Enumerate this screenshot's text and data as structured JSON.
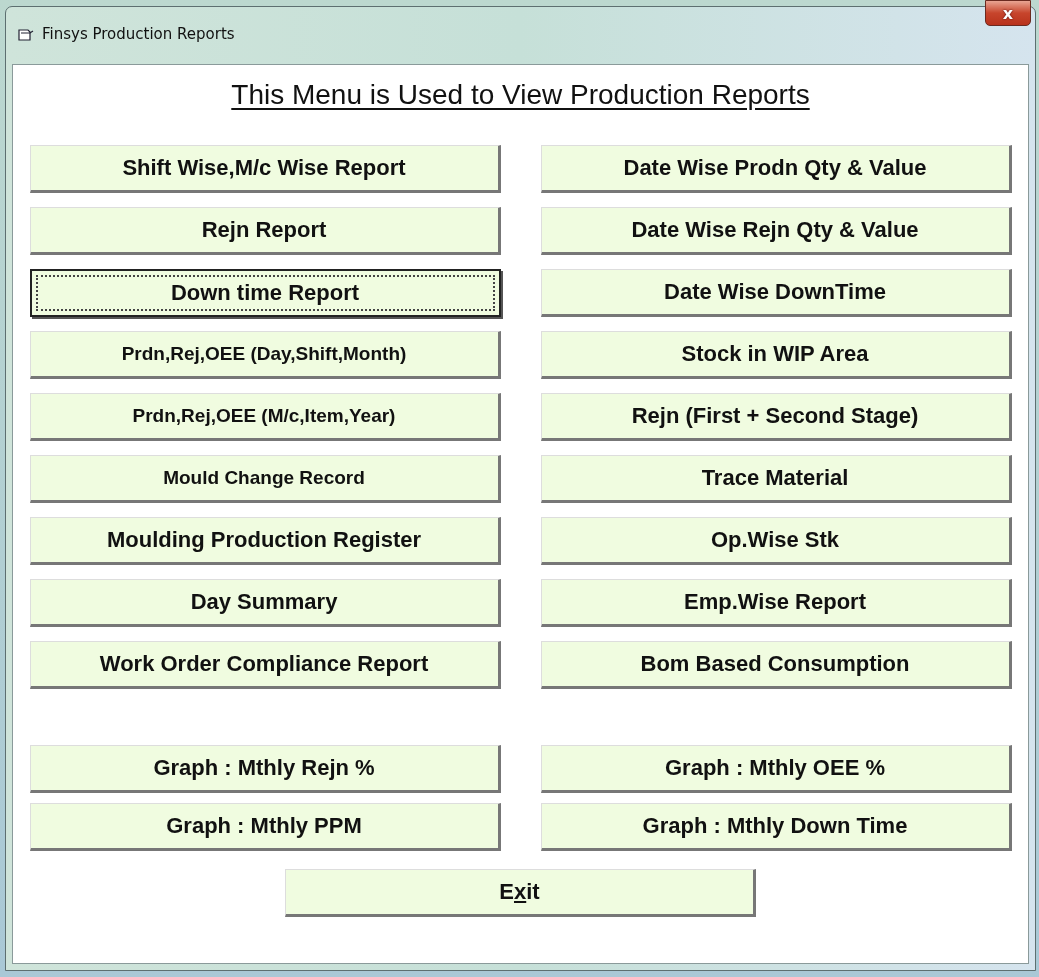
{
  "window": {
    "title": "Finsys Production Reports",
    "close_label": "x"
  },
  "heading": "This Menu is Used to View Production Reports",
  "report_buttons": [
    {
      "label": "Shift Wise,M/c Wise Report",
      "focused": false,
      "small": false
    },
    {
      "label": "Date Wise Prodn Qty & Value",
      "focused": false,
      "small": false
    },
    {
      "label": "Rejn Report",
      "focused": false,
      "small": false
    },
    {
      "label": "Date Wise Rejn Qty & Value",
      "focused": false,
      "small": false
    },
    {
      "label": "Down time Report",
      "focused": true,
      "small": false
    },
    {
      "label": "Date Wise DownTime",
      "focused": false,
      "small": false
    },
    {
      "label": "Prdn,Rej,OEE (Day,Shift,Month)",
      "focused": false,
      "small": true
    },
    {
      "label": "Stock in WIP Area",
      "focused": false,
      "small": false
    },
    {
      "label": "Prdn,Rej,OEE (M/c,Item,Year)",
      "focused": false,
      "small": true
    },
    {
      "label": "Rejn (First + Second Stage)",
      "focused": false,
      "small": false
    },
    {
      "label": "Mould Change Record",
      "focused": false,
      "small": true
    },
    {
      "label": "Trace Material",
      "focused": false,
      "small": false
    },
    {
      "label": "Moulding Production Register",
      "focused": false,
      "small": false
    },
    {
      "label": "Op.Wise Stk",
      "focused": false,
      "small": false
    },
    {
      "label": "Day Summary",
      "focused": false,
      "small": false
    },
    {
      "label": "Emp.Wise Report",
      "focused": false,
      "small": false
    },
    {
      "label": "Work Order Compliance Report",
      "focused": false,
      "small": false
    },
    {
      "label": "Bom Based Consumption",
      "focused": false,
      "small": false
    }
  ],
  "graph_buttons": [
    {
      "label": "Graph : Mthly Rejn %",
      "focused": false,
      "small": false
    },
    {
      "label": "Graph : Mthly OEE %",
      "focused": false,
      "small": false
    },
    {
      "label": "Graph : Mthly PPM",
      "focused": false,
      "small": false
    },
    {
      "label": "Graph : Mthly Down Time",
      "focused": false,
      "small": false
    }
  ],
  "exit_button": {
    "before": "E",
    "mnemonic": "x",
    "after": "it"
  }
}
